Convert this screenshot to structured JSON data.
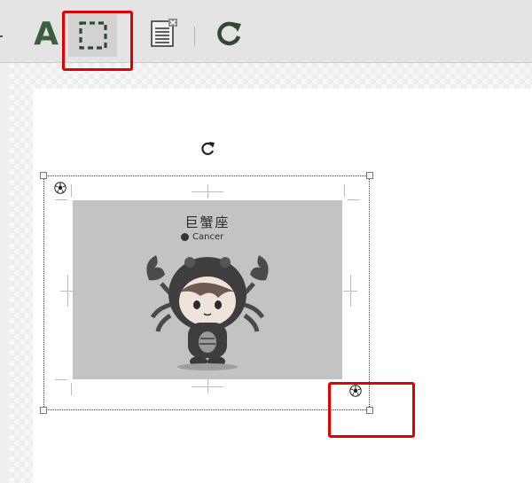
{
  "toolbar": {
    "text_tool": {
      "label": "A",
      "icon": "text-tool-icon"
    },
    "select_tool": {
      "icon": "dashed-selection-icon",
      "active": true
    },
    "page_tool": {
      "icon": "page-remove-icon"
    },
    "rotate_tool": {
      "icon": "rotate-icon"
    }
  },
  "selection": {
    "rotate_icon": "rotate-handle-icon",
    "corner_ball_icon": "soccer-ball-icon"
  },
  "image": {
    "title": "巨蟹座",
    "subtitle": "Cancer",
    "icon": "crab-mascot-illustration"
  },
  "highlights": {
    "color": "#e00000"
  }
}
